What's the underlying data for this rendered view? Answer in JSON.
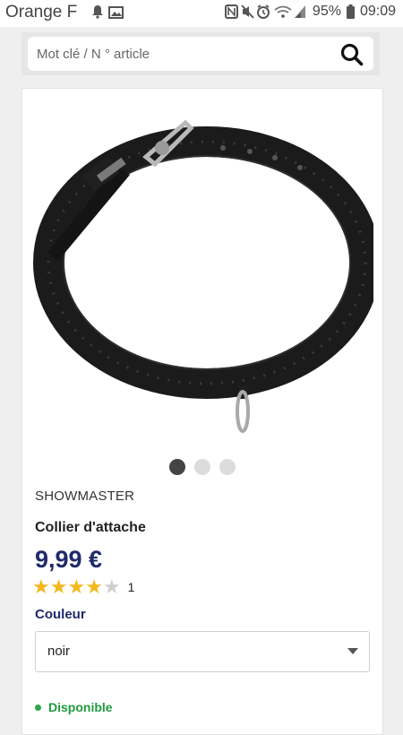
{
  "status_bar": {
    "carrier": "Orange F",
    "battery": "95%",
    "time": "09:09"
  },
  "search": {
    "placeholder": "Mot clé / N ° article"
  },
  "product": {
    "brand": "SHOWMASTER",
    "title": "Collier d'attache",
    "price": "9,99 €",
    "rating_value": 4,
    "rating_max": 5,
    "rating_count": "1",
    "image_count": 3,
    "active_image_index": 0,
    "color_label": "Couleur",
    "color_selected": "noir",
    "availability": "Disponible"
  },
  "colors": {
    "brand_blue": "#1e2a6a",
    "star": "#f3b81c",
    "available_green": "#1f9a3f"
  }
}
